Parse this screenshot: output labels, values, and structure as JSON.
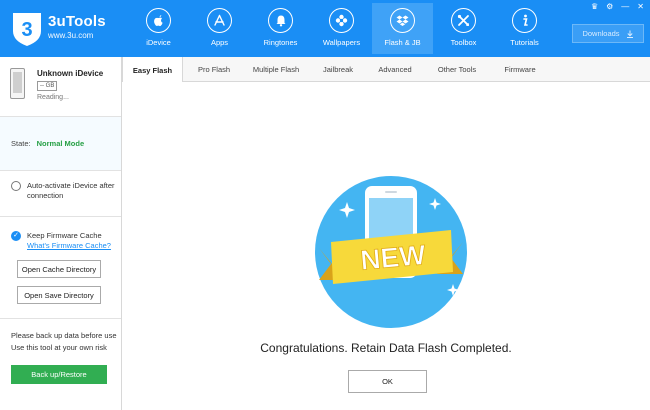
{
  "app": {
    "title": "3uTools",
    "subtitle": "www.3u.com",
    "logo_glyph": "3"
  },
  "nav": [
    {
      "label": "iDevice",
      "icon": "apple-icon"
    },
    {
      "label": "Apps",
      "icon": "app-store-icon"
    },
    {
      "label": "Ringtones",
      "icon": "bell-icon"
    },
    {
      "label": "Wallpapers",
      "icon": "flower-icon"
    },
    {
      "label": "Flash & JB",
      "icon": "dropbox-icon",
      "active": true
    },
    {
      "label": "Toolbox",
      "icon": "tools-icon"
    },
    {
      "label": "Tutorials",
      "icon": "info-icon"
    }
  ],
  "header": {
    "downloads_label": "Downloads"
  },
  "device": {
    "name": "Unknown iDevice",
    "capacity": "-- GB",
    "status": "Reading..."
  },
  "state": {
    "label": "State:",
    "value": "Normal Mode"
  },
  "options": {
    "auto_activate": "Auto-activate iDevice after connection",
    "keep_cache": "Keep Firmware Cache",
    "cache_link": "What's Firmware Cache?",
    "open_cache": "Open Cache Directory",
    "open_save": "Open Save Directory"
  },
  "backup": {
    "note_line1": "Please back up data before use",
    "note_line2": "Use this tool at your own risk",
    "button": "Back up/Restore"
  },
  "tabs": [
    {
      "label": "Easy Flash",
      "active": true
    },
    {
      "label": "Pro Flash"
    },
    {
      "label": "Multiple Flash"
    },
    {
      "label": "Jailbreak"
    },
    {
      "label": "Advanced"
    },
    {
      "label": "Other Tools"
    },
    {
      "label": "Firmware"
    }
  ],
  "result": {
    "badge_text": "NEW",
    "message": "Congratulations. Retain Data Flash Completed.",
    "ok_label": "OK"
  },
  "colors": {
    "brand": "#1a8ef5",
    "success": "#27a046",
    "button_green": "#31ae52",
    "ribbon": "#f7d93a"
  }
}
